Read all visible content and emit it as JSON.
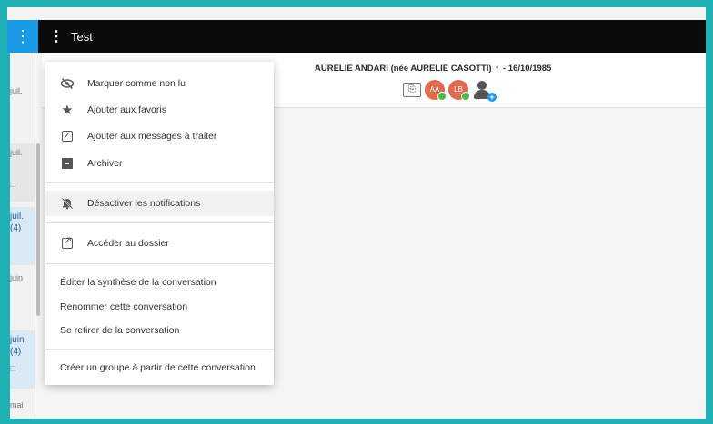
{
  "topbar": {
    "accent_icon": "⋮",
    "menu_icon": "⋮",
    "title": "Test"
  },
  "left_column": {
    "items": [
      {
        "text": "juil."
      },
      {
        "text": "juil."
      },
      {
        "text": "juil. (4)"
      },
      {
        "text": "juin"
      },
      {
        "text": "juin (4)"
      },
      {
        "text": "mai"
      }
    ]
  },
  "patient": {
    "header": "AURELIE ANDARI (née AURELIE CASOTTI) ♀ - 16/10/1985",
    "avatars": [
      {
        "initials": "AA",
        "color": "#e06a4e"
      },
      {
        "initials": "LB",
        "color": "#e06a4e"
      }
    ],
    "add_member_icon": "person-add-icon",
    "document_icon": "document-icon"
  },
  "menu": {
    "items": [
      {
        "label": "Marquer comme non lu",
        "icon": "eye-slash-icon"
      },
      {
        "label": "Ajouter aux favoris",
        "icon": "star-icon"
      },
      {
        "label": "Ajouter aux messages à traiter",
        "icon": "checkbox-icon"
      },
      {
        "label": "Archiver",
        "icon": "archive-icon"
      },
      {
        "label": "Désactiver les notifications",
        "icon": "bell-off-icon"
      },
      {
        "label": "Accéder au dossier",
        "icon": "external-link-icon"
      },
      {
        "label": "Éditer la synthèse de la conversation"
      },
      {
        "label": "Renommer cette conversation"
      },
      {
        "label": "Se retirer de la conversation"
      },
      {
        "label": "Créer un groupe à partir de cette conversation"
      }
    ]
  },
  "colors": {
    "frame": "#1fb0b3",
    "topbar": "#0b0b0b",
    "accent": "#1a9be8",
    "avatar": "#e06a4e",
    "online": "#4cb847"
  }
}
